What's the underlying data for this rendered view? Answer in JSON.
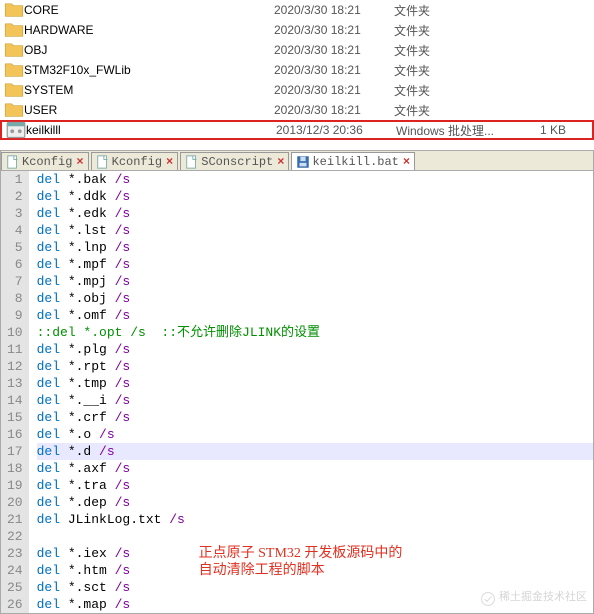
{
  "files": [
    {
      "name": "CORE",
      "date": "2020/3/30 18:21",
      "type": "文件夹",
      "size": "",
      "kind": "folder"
    },
    {
      "name": "HARDWARE",
      "date": "2020/3/30 18:21",
      "type": "文件夹",
      "size": "",
      "kind": "folder"
    },
    {
      "name": "OBJ",
      "date": "2020/3/30 18:21",
      "type": "文件夹",
      "size": "",
      "kind": "folder"
    },
    {
      "name": "STM32F10x_FWLib",
      "date": "2020/3/30 18:21",
      "type": "文件夹",
      "size": "",
      "kind": "folder"
    },
    {
      "name": "SYSTEM",
      "date": "2020/3/30 18:21",
      "type": "文件夹",
      "size": "",
      "kind": "folder"
    },
    {
      "name": "USER",
      "date": "2020/3/30 18:21",
      "type": "文件夹",
      "size": "",
      "kind": "folder"
    },
    {
      "name": "keilkilll",
      "date": "2013/12/3 20:36",
      "type": "Windows 批处理...",
      "size": "1 KB",
      "kind": "bat",
      "highlight": true
    }
  ],
  "tabs": [
    {
      "label": "Kconfig",
      "active": false
    },
    {
      "label": "Kconfig",
      "active": false
    },
    {
      "label": "SConscript",
      "active": false
    },
    {
      "label": "keilkill.bat",
      "active": true
    }
  ],
  "code": [
    {
      "n": 1,
      "t": "del *.bak /s"
    },
    {
      "n": 2,
      "t": "del *.ddk /s"
    },
    {
      "n": 3,
      "t": "del *.edk /s"
    },
    {
      "n": 4,
      "t": "del *.lst /s"
    },
    {
      "n": 5,
      "t": "del *.lnp /s"
    },
    {
      "n": 6,
      "t": "del *.mpf /s"
    },
    {
      "n": 7,
      "t": "del *.mpj /s"
    },
    {
      "n": 8,
      "t": "del *.obj /s"
    },
    {
      "n": 9,
      "t": "del *.omf /s"
    },
    {
      "n": 10,
      "c": "::del *.opt /s  ::不允许删除JLINK的设置"
    },
    {
      "n": 11,
      "t": "del *.plg /s"
    },
    {
      "n": 12,
      "t": "del *.rpt /s"
    },
    {
      "n": 13,
      "t": "del *.tmp /s"
    },
    {
      "n": 14,
      "t": "del *.__i /s"
    },
    {
      "n": 15,
      "t": "del *.crf /s"
    },
    {
      "n": 16,
      "t": "del *.o /s"
    },
    {
      "n": 17,
      "t": "del *.d /s",
      "hl": true
    },
    {
      "n": 18,
      "t": "del *.axf /s"
    },
    {
      "n": 19,
      "t": "del *.tra /s"
    },
    {
      "n": 20,
      "t": "del *.dep /s"
    },
    {
      "n": 21,
      "t": "del JLinkLog.txt /s"
    },
    {
      "n": 22,
      "blank": true
    },
    {
      "n": 23,
      "t": "del *.iex /s"
    },
    {
      "n": 24,
      "t": "del *.htm /s"
    },
    {
      "n": 25,
      "t": "del *.sct /s"
    },
    {
      "n": 26,
      "t": "del *.map /s"
    }
  ],
  "annotation": {
    "line1": "正点原子 STM32 开发板源码中的",
    "line2": "自动清除工程的脚本"
  },
  "watermark": "稀土掘金技术社区"
}
